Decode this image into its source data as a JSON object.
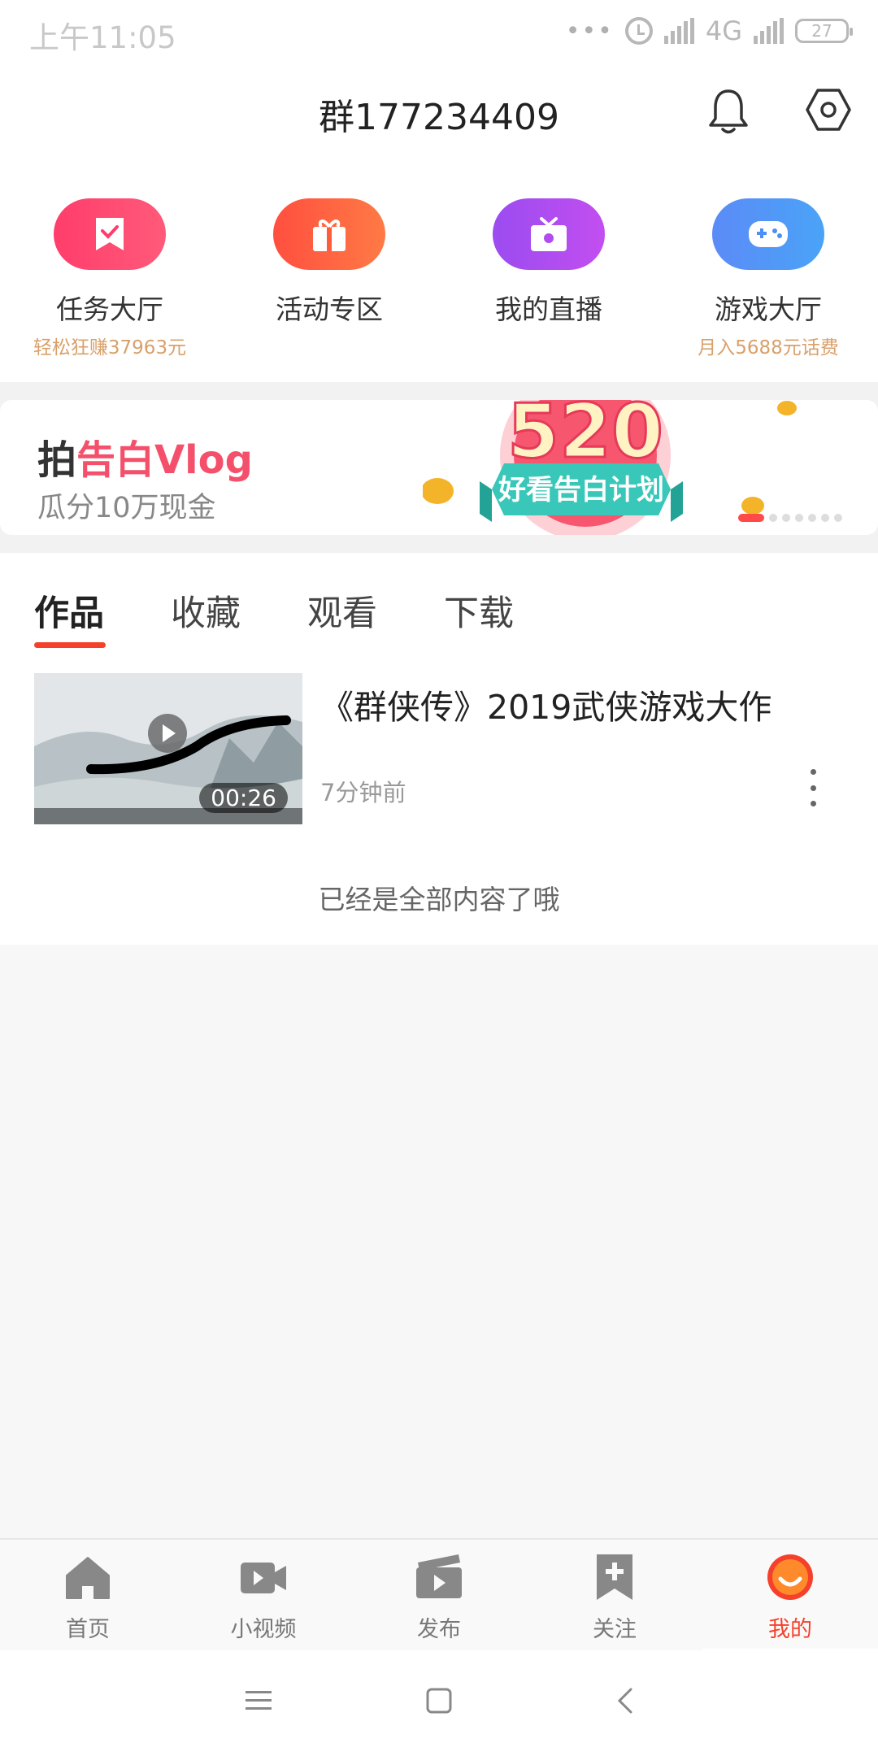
{
  "status_bar": {
    "time": "上午11:05",
    "network": "4G",
    "battery": "27"
  },
  "header": {
    "title": "群177234409"
  },
  "quick_actions": [
    {
      "label": "任务大厅",
      "sub": "轻松狂赚37963元",
      "color": "#ff3d6b",
      "icon": "task-icon"
    },
    {
      "label": "活动专区",
      "sub": "",
      "color": "#ff5b3d",
      "icon": "gift-icon"
    },
    {
      "label": "我的直播",
      "sub": "",
      "color": "#b14cf0",
      "icon": "tv-icon"
    },
    {
      "label": "游戏大厅",
      "sub": "月入5688元话费",
      "color": "#4b8ff7",
      "icon": "gamepad-icon"
    }
  ],
  "banner": {
    "title_prefix": "拍",
    "title_highlight": "告白Vlog",
    "subtitle": "瓜分10万现金",
    "art_number": "520",
    "art_ribbon": "好看告白计划"
  },
  "tabs": [
    "作品",
    "收藏",
    "观看",
    "下载"
  ],
  "video": {
    "title": "《群侠传》2019武侠游戏大作",
    "time": "7分钟前",
    "duration": "00:26"
  },
  "end_text": "已经是全部内容了哦",
  "bottom_nav": [
    "首页",
    "小视频",
    "发布",
    "关注",
    "我的"
  ]
}
